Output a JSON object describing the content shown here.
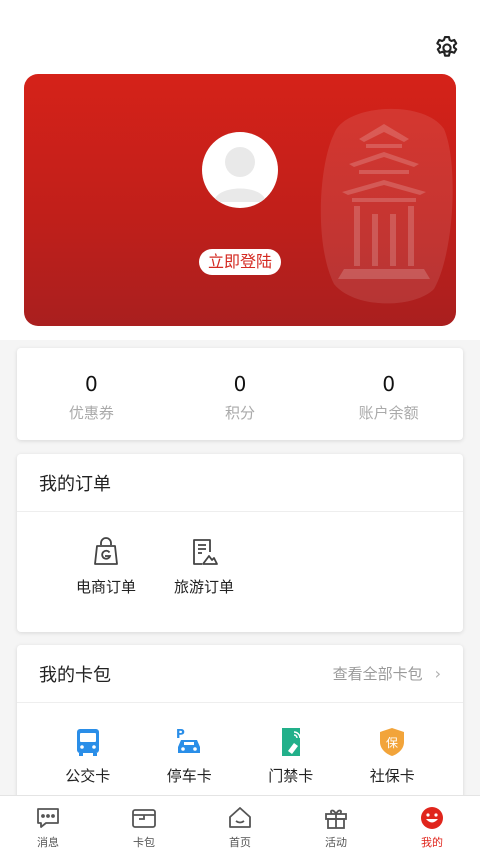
{
  "header": {
    "settings_icon": "gear-icon"
  },
  "banner": {
    "login_label": "立即登陆",
    "accent_color": "#d42a22",
    "avatar_icon": "default-avatar-icon"
  },
  "stats": [
    {
      "value": "0",
      "label": "优惠券"
    },
    {
      "value": "0",
      "label": "积分"
    },
    {
      "value": "0",
      "label": "账户余额"
    }
  ],
  "orders": {
    "title": "我的订单",
    "items": [
      {
        "label": "电商订单",
        "icon": "shopping-bag-icon"
      },
      {
        "label": "旅游订单",
        "icon": "travel-document-icon"
      }
    ]
  },
  "wallet": {
    "title": "我的卡包",
    "view_all": "查看全部卡包",
    "items": [
      {
        "label": "公交卡",
        "icon": "bus-icon",
        "color": "#2a8ee8"
      },
      {
        "label": "停车卡",
        "icon": "parking-car-icon",
        "color": "#2a8ee8"
      },
      {
        "label": "门禁卡",
        "icon": "access-door-icon",
        "color": "#22b08a"
      },
      {
        "label": "社保卡",
        "icon": "insurance-shield-icon",
        "color": "#f2a43a"
      }
    ]
  },
  "tabbar": {
    "active_color": "#e0251c",
    "items": [
      {
        "label": "消息",
        "icon": "message-icon"
      },
      {
        "label": "卡包",
        "icon": "wallet-icon"
      },
      {
        "label": "首页",
        "icon": "home-icon"
      },
      {
        "label": "活动",
        "icon": "gift-icon"
      },
      {
        "label": "我的",
        "icon": "smiley-icon"
      }
    ]
  }
}
